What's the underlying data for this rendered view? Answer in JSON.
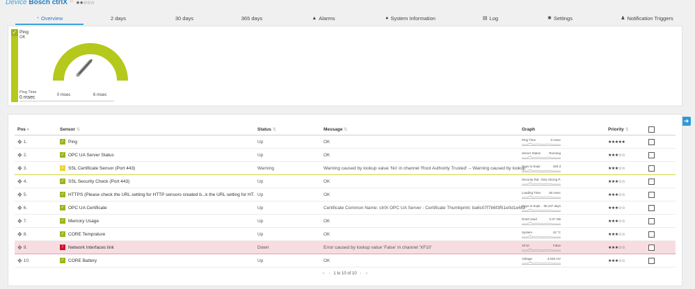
{
  "device": {
    "label": "Device",
    "name": "Bosch ctrlX",
    "flag": "⚐",
    "stars": "★★☆☆☆"
  },
  "tabs": [
    {
      "label": "Overview",
      "icon": "◔"
    },
    {
      "label": "2  days",
      "icon": ""
    },
    {
      "label": "30  days",
      "icon": ""
    },
    {
      "label": "365 days",
      "icon": ""
    },
    {
      "label": "Alarms",
      "icon": "▲"
    },
    {
      "label": "System Information",
      "icon": "●"
    },
    {
      "label": "Log",
      "icon": "▤"
    },
    {
      "label": "Settings",
      "icon": "✱"
    },
    {
      "label": "Notification Triggers",
      "icon": "♟"
    }
  ],
  "ping": {
    "name": "Ping",
    "status": "OK",
    "time_label": "Ping Time",
    "time_value": "0 msec",
    "gauge_min": "0 msec",
    "gauge_max": "6 msec",
    "gauge_color": "#b5c81c"
  },
  "table": {
    "headers": {
      "pos": "Pos",
      "sensor": "Sensor",
      "status": "Status",
      "message": "Message",
      "graph": "Graph",
      "priority": "Priority"
    },
    "rows": [
      {
        "pos": "1.",
        "sensor": "Ping",
        "status": "Up",
        "message": "OK",
        "graph_label": "Ping Time",
        "graph_value": "0 msec",
        "priority": "★★★★★",
        "state": "ok"
      },
      {
        "pos": "2.",
        "sensor": "OPC UA Server Status",
        "status": "Up",
        "message": "OK",
        "graph_label": "Server Status",
        "graph_value": "Running",
        "priority": "★★★☆☆",
        "state": "ok"
      },
      {
        "pos": "3.",
        "sensor": "SSL Certificate Sensor (Port 443)",
        "status": "Warning",
        "message": "Warning caused by lookup value 'No' in channel 'Root Authority Trusted' -- Warning caused by lookup valu...",
        "graph_label": "Days to Expir.",
        "graph_value": "328 d",
        "priority": "★★★☆☆",
        "state": "warn"
      },
      {
        "pos": "4.",
        "sensor": "SSL Security Check (Port 443)",
        "status": "Up",
        "message": "OK",
        "graph_label": "Security Rat.",
        "graph_value": "Only Strong P.",
        "priority": "★★★☆☆",
        "state": "ok"
      },
      {
        "pos": "5.",
        "sensor": "HTTPS (Please check the URL setting for HTTP sensors created b...k the URL setting for HT...",
        "status": "Up",
        "message": "OK",
        "graph_label": "Loading Time",
        "graph_value": "36 msec",
        "priority": "★★★☆☆",
        "state": "ok"
      },
      {
        "pos": "6.",
        "sensor": "OPC UA Certificate",
        "status": "Up",
        "message": "Certificate Common Name: ctrlX OPC UA Server - Certificate Thumbprint: ba6c07f7b6f3f51e0d1e6fd6dd7...",
        "graph_label": "Days to Expir.",
        "graph_value": "85,107 days",
        "priority": "★★★☆☆",
        "state": "ok"
      },
      {
        "pos": "7.",
        "sensor": "Memory Usage",
        "status": "Up",
        "message": "OK",
        "graph_label": "RAM Used",
        "graph_value": "0.37 GB",
        "priority": "★★★☆☆",
        "state": "ok"
      },
      {
        "pos": "8.",
        "sensor": "CORE Temprature",
        "status": "Up",
        "message": "OK",
        "graph_label": "System",
        "graph_value": "43 °C",
        "priority": "★★★☆☆",
        "state": "ok"
      },
      {
        "pos": "9.",
        "sensor": "Network Interfaces link",
        "status": "Down",
        "message": "Error caused by lookup value 'False' in channel 'XF10'",
        "graph_label": "XF10",
        "graph_value": "False",
        "priority": "★★★☆☆",
        "state": "err"
      },
      {
        "pos": "10.",
        "sensor": "CORE Battery",
        "status": "Up",
        "message": "OK",
        "graph_label": "Voltage",
        "graph_value": "3.045 mV",
        "priority": "★★★☆☆",
        "state": "ok"
      }
    ],
    "pagination": {
      "text": "1 to 10 of 10"
    }
  },
  "icons": {
    "drag": "move-icon",
    "check": "check-icon",
    "error": "error-icon",
    "expand": "plus-circle-icon"
  }
}
